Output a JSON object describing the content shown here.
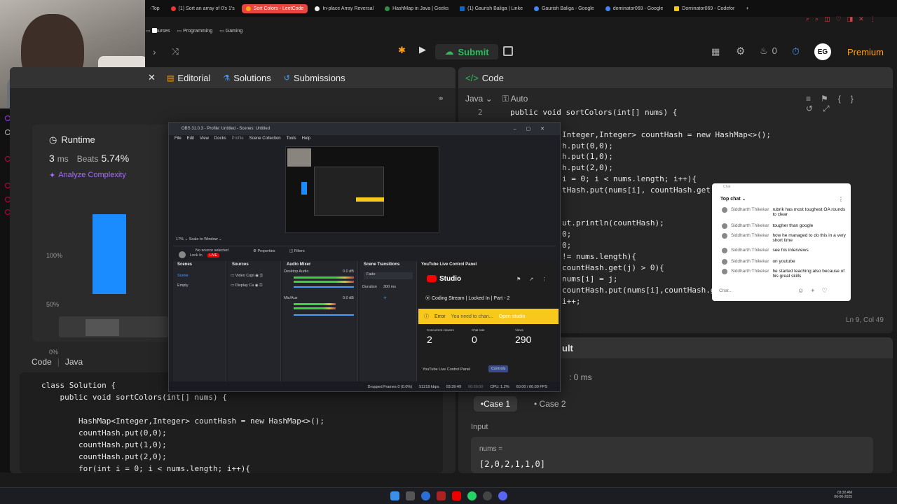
{
  "browser": {
    "tabs": [
      {
        "label": "-Top",
        "active": false
      },
      {
        "label": "(1) Sort an array of 0's 1's",
        "active": false
      },
      {
        "label": "Sort Colors - LeetCode",
        "active": true
      },
      {
        "label": "In-place Array Reversal",
        "active": false
      },
      {
        "label": "HashMap in Java | Geeks",
        "active": false
      },
      {
        "label": "(1) Gaurish Baliga | Linke",
        "active": false
      },
      {
        "label": "Gaurish Baliga - Google",
        "active": false
      },
      {
        "label": "dominator069 - Google",
        "active": false
      },
      {
        "label": "Dominator069 - Codefor",
        "active": false
      }
    ],
    "new_tab": "+",
    "bookmarks": [
      "Courses",
      "Programming",
      "Gaming"
    ]
  },
  "leetcode": {
    "submit_label": "Submit",
    "fire_count": "0",
    "premium_label": "Premium",
    "left_tabs": [
      "Editorial",
      "Solutions",
      "Submissions"
    ],
    "runtime": {
      "title": "Runtime",
      "value": "3",
      "unit": "ms",
      "beats_label": "Beats",
      "beats_value": "5.74%",
      "analyze": "Analyze Complexity",
      "y_ticks": [
        "100%",
        "50%",
        "0%"
      ]
    },
    "code_label": "Code",
    "lang_label": "Java",
    "submission_code": [
      "class Solution {",
      "    public void sortColors(int[] nums) {",
      "",
      "        HashMap<Integer,Integer> countHash = new HashMap<>();",
      "        countHash.put(0,0);",
      "        countHash.put(1,0);",
      "        countHash.put(2,0);",
      "        for(int i = 0; i < nums.length; i++){"
    ],
    "editor": {
      "title": "Code",
      "language": "Java",
      "mode": "Auto",
      "line_no": "2",
      "lines": [
        "public void sortColors(int[] nums) {",
        "",
        "Integer,Integer> countHash = new HashMap<>();",
        "h.put(0,0);",
        "h.put(1,0);",
        "h.put(2,0);",
        "i = 0; i < nums.length; i++){",
        "tHash.put(nums[i], countHash.get(n",
        "",
        "",
        "ut.println(countHash);",
        "0;",
        "0;",
        "!= nums.length){",
        "countHash.get(j) > 0){",
        "nums[i] = j;",
        "countHash.put(nums[i],countHash.ge",
        "i++;"
      ],
      "cursor_pos": "Ln 9, Col 49"
    },
    "result": {
      "title_fragment": "ult",
      "runtime_fragment": ": 0 ms",
      "cases": [
        "Case 1",
        "Case 2"
      ],
      "input_label": "Input",
      "var_label": "nums =",
      "var_value": "[2,0,2,1,1,0]"
    }
  },
  "obs": {
    "title": "OBS 31.0.3 - Profile: Untitled - Scenes: Untitled",
    "menu": [
      "File",
      "Edit",
      "View",
      "Docks",
      "Profile",
      "Scene Collection",
      "Tools",
      "Help"
    ],
    "scale_label": "Scale to Window",
    "no_source": "No source selected",
    "properties": "Properties",
    "filters": "Filters",
    "live_badge": "LIVE",
    "lock_in": "Lock In",
    "docks": {
      "scenes": {
        "title": "Scenes",
        "items": [
          "Scene",
          "Empty"
        ]
      },
      "sources": {
        "title": "Sources",
        "items": [
          "Video Capt",
          "Display Ca"
        ]
      },
      "audio": {
        "title": "Audio Mixer",
        "ch1": "Desktop Audio",
        "ch1_db": "0.0 dB",
        "ch2": "Mic/Aux",
        "ch2_db": "0.0 dB"
      },
      "transitions": {
        "title": "Scene Transitions",
        "type": "Fade",
        "duration_label": "Duration",
        "duration_value": "300 ms"
      }
    },
    "youtube": {
      "panel_title": "YouTube Live Control Panel",
      "studio": "Studio",
      "stream_title": "Coding Stream | Locked In | Part - 2",
      "error_label": "Error",
      "error_msg": "You need to chan...",
      "open_studio": "Open studio",
      "stats": [
        {
          "label": "Concurrent viewers",
          "value": "2"
        },
        {
          "label": "Chat rate",
          "value": "0"
        },
        {
          "label": "Views",
          "value": "290"
        }
      ],
      "tab_panel": "YouTube Live Control Panel",
      "tab_controls": "Controls"
    },
    "status": {
      "dropped": "Dropped Frames 0 (0.0%)",
      "bitrate": "51219 kbps",
      "live_time": "03:39:49",
      "rec_time": "00:00:00",
      "cpu": "CPU: 1.2%",
      "fps": "60.00 / 60.00 FPS"
    }
  },
  "chat": {
    "header_small": "Chat",
    "mode": "Top chat",
    "placeholder": "Chat...",
    "messages": [
      {
        "author": "Siddharth Thikekar",
        "text": "rubrik has most toughest OA rounds to clear"
      },
      {
        "author": "Siddharth Thikekar",
        "text": "tougher than google"
      },
      {
        "author": "Siddharth Thikekar",
        "text": "how he managed to do this in a very short time"
      },
      {
        "author": "Siddharth Thikekar",
        "text": "see his interviews"
      },
      {
        "author": "Siddharth Thikekar",
        "text": "on youtube"
      },
      {
        "author": "Siddharth Thikekar",
        "text": "he started teaching also because of his great skills"
      }
    ]
  },
  "taskbar": {
    "time": "03:30 AM",
    "date": "06-06-2025"
  },
  "colors": {
    "accent_green": "#2cbb5d",
    "accent_orange": "#ffa116",
    "bar_blue": "#1a8cff",
    "yt_red": "#ff0000",
    "error_yellow": "#f8c91c"
  }
}
